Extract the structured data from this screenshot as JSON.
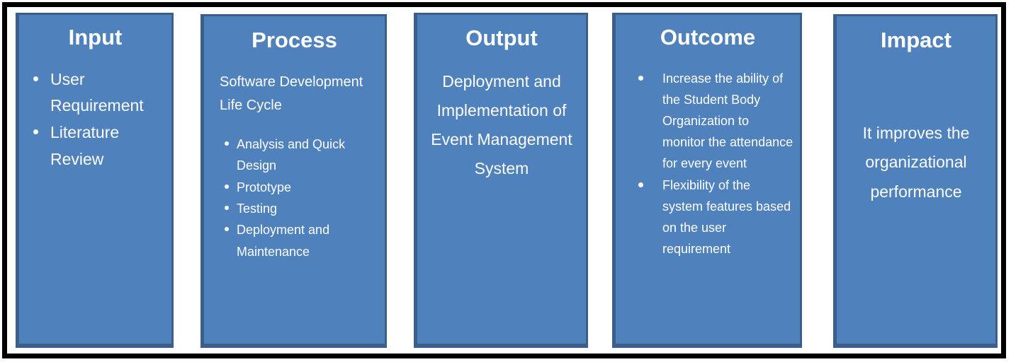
{
  "diagram": {
    "type": "five-stage-logic-model",
    "frame_color": "#000000",
    "box_fill": "#4F81BD",
    "box_border": "#3B5F8A",
    "text_color": "#FFFFFF",
    "boxes": [
      {
        "id": "input",
        "title": "Input",
        "layout": "bulleted",
        "bullets": [
          "User Requirement",
          "Literature Review"
        ]
      },
      {
        "id": "process",
        "title": "Process",
        "layout": "lead-plus-bullets",
        "lead": "Software Development Life Cycle",
        "bullets": [
          "Analysis and Quick Design",
          "Prototype",
          "Testing",
          "Deployment and Maintenance"
        ]
      },
      {
        "id": "output",
        "title": "Output",
        "layout": "centered-paragraph",
        "text": "Deployment and Implementation of Event Management System"
      },
      {
        "id": "outcome",
        "title": "Outcome",
        "layout": "bulleted",
        "bullets": [
          "Increase the ability of the Student Body Organization to monitor the attendance for every event",
          "Flexibility of the system features based on the user requirement"
        ]
      },
      {
        "id": "impact",
        "title": "Impact",
        "layout": "centered-paragraph",
        "text": "It improves the organizational performance"
      }
    ]
  }
}
